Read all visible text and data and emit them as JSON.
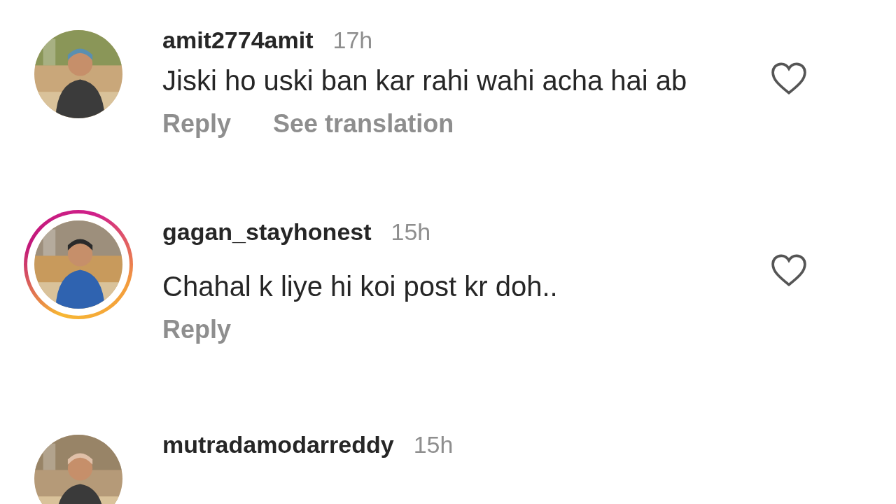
{
  "comments": [
    {
      "username": "amit2774amit",
      "time": "17h",
      "text": "Jiski ho uski ban kar rahi wahi acha hai ab",
      "story_ring": false,
      "liked": false,
      "avatar": {
        "kind": "picture"
      },
      "actions": [
        "Reply",
        "See translation"
      ]
    },
    {
      "username": "gagan_stayhonest",
      "time": "15h",
      "text": "Chahal k liye hi koi post kr doh..",
      "story_ring": true,
      "liked": false,
      "avatar": {
        "kind": "picture"
      },
      "actions": [
        "Reply"
      ]
    },
    {
      "username": "mutradamodarreddy",
      "time": "15h",
      "story_ring": false,
      "avatar": {
        "kind": "picture"
      }
    }
  ]
}
